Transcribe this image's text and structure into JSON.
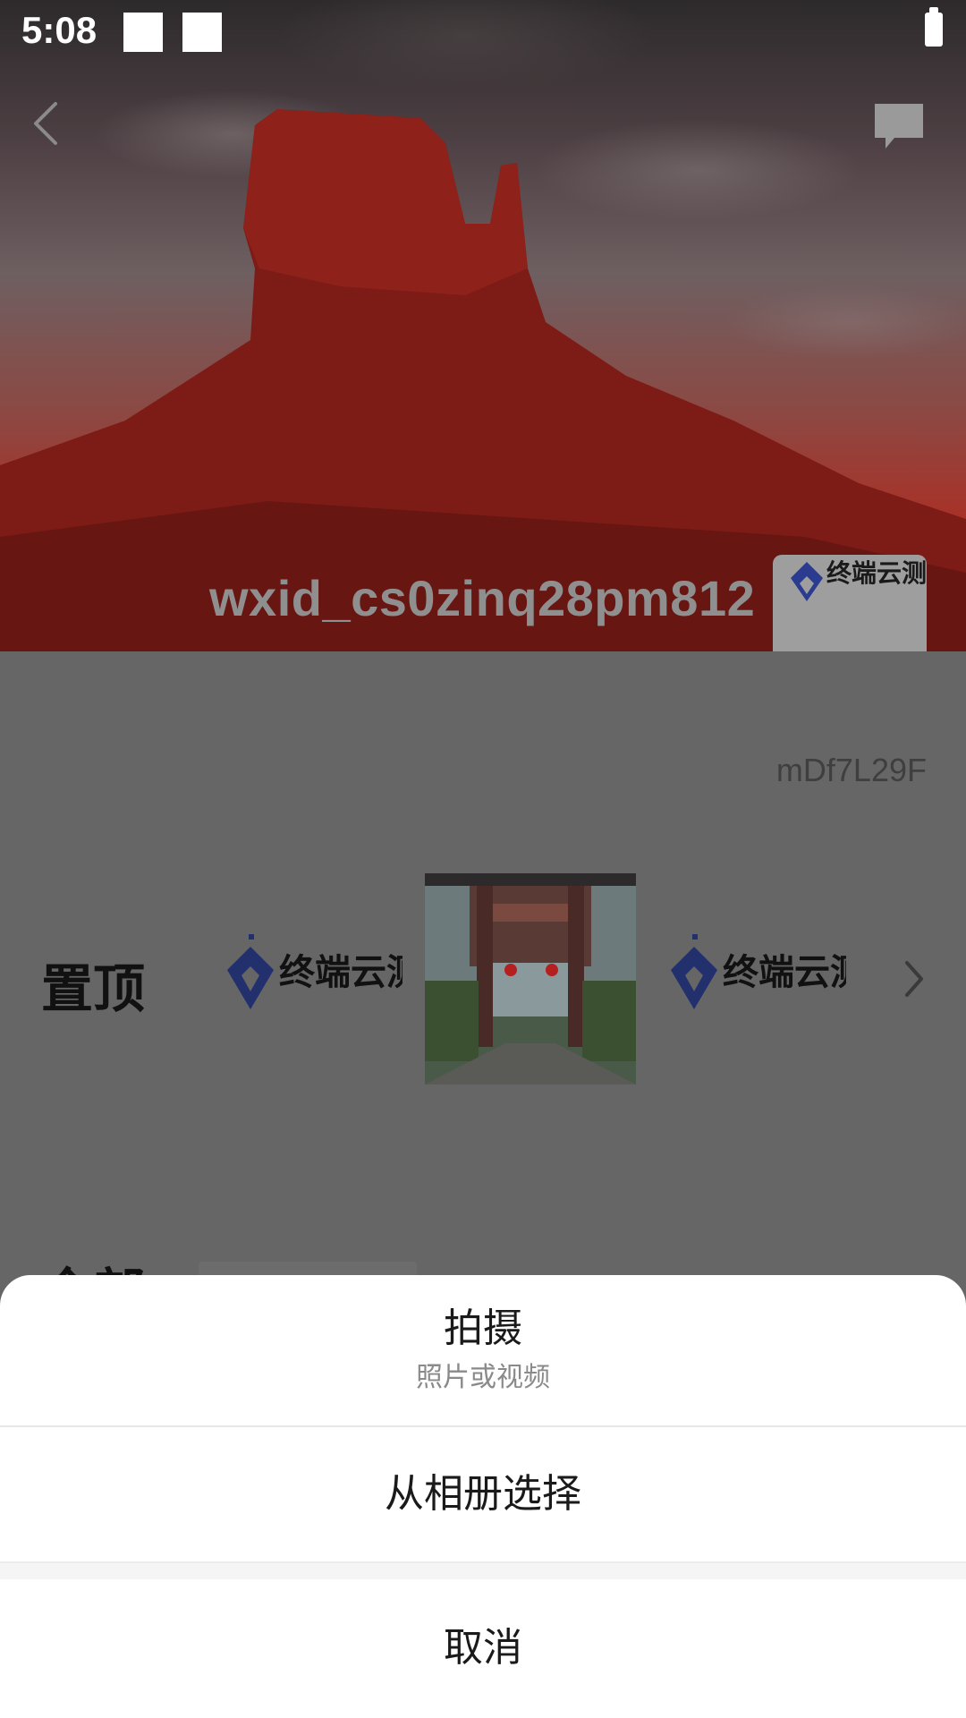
{
  "status_bar": {
    "time": "5:08"
  },
  "profile": {
    "username": "wxid_cs0zinq28pm812",
    "user_id": "mDf7L29F"
  },
  "moments": {
    "pinned_label": "置顶",
    "all_label": "全部",
    "logo_text": "终端云测"
  },
  "action_sheet": {
    "shoot_title": "拍摄",
    "shoot_subtitle": "照片或视频",
    "album": "从相册选择",
    "cancel": "取消"
  },
  "colors": {
    "overlay_gray": "#666666",
    "sheet_bg": "#ffffff",
    "logo_blue": "#2b3b8f"
  }
}
